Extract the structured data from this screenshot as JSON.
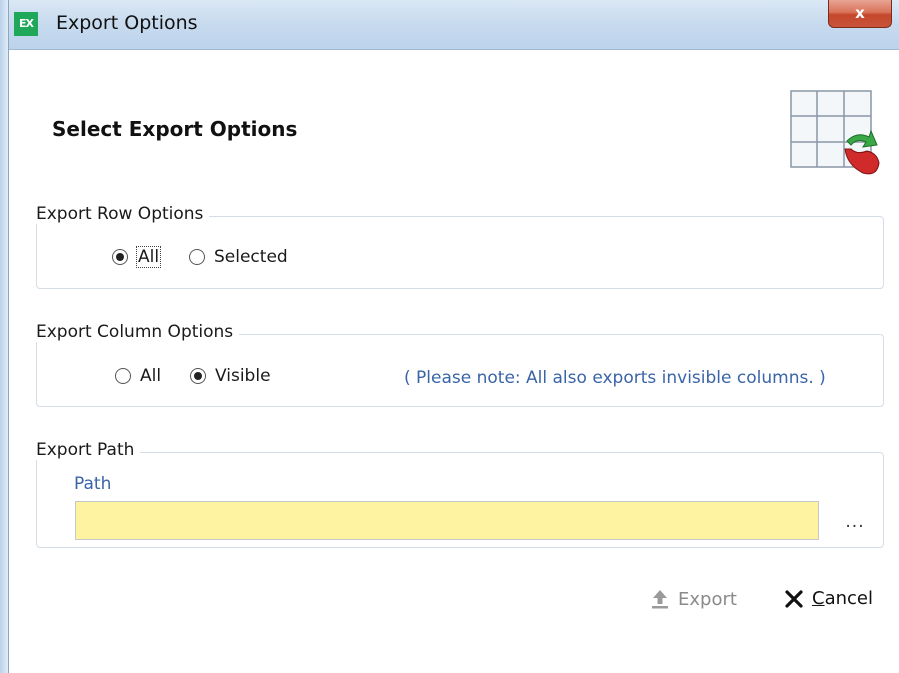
{
  "window": {
    "icon_text": "EX",
    "title": "Export Options",
    "close_label": "x"
  },
  "header": {
    "heading": "Select Export Options",
    "icon": "table-export-icon"
  },
  "row_options": {
    "title": "Export Row Options",
    "options": [
      {
        "label": "All",
        "checked": true
      },
      {
        "label": "Selected",
        "checked": false
      }
    ]
  },
  "column_options": {
    "title": "Export Column Options",
    "options": [
      {
        "label": "All",
        "checked": false
      },
      {
        "label": "Visible",
        "checked": true
      }
    ],
    "note": "( Please note: All also exports invisible columns. )"
  },
  "export_path": {
    "title": "Export Path",
    "field_label": "Path",
    "value": "",
    "browse_label": "..."
  },
  "actions": {
    "export_label": "Export",
    "cancel_label": "Cancel"
  },
  "colors": {
    "accent_blue": "#3a64a8",
    "path_field_bg": "#fdf3a0",
    "close_red": "#c4472b",
    "app_icon_green": "#1fa85a"
  }
}
